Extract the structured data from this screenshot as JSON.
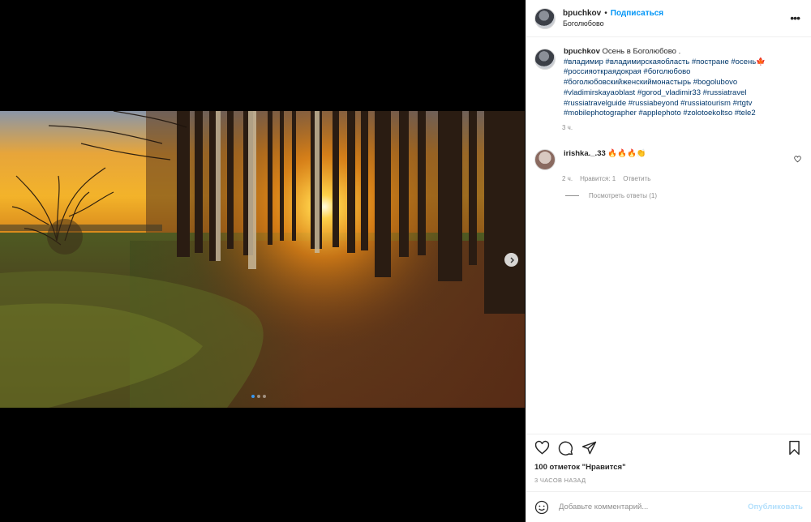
{
  "post": {
    "username": "bpuchkov",
    "separator": "•",
    "follow_label": "Подписаться",
    "location": "Боголюбово",
    "more_label": "•••"
  },
  "caption": {
    "username": "bpuchkov",
    "text": "Осень в Боголюбово .",
    "hashtags_line1": "#владимир #владимирскаяобласть #пострaне #осень🍁",
    "hashtags_rest": "#россияоткраядокрая #боголюбово #боголюбовскийженскиймонастырь #bogolubovo #vladimirskayaoblast #gorod_vladimir33 #russiatravel #russiatravelguide #russiabeyond #russiatourism #rtgtv #mobilephotographer #applephoto #zolotoekoltso #tele2",
    "time": "3 ч."
  },
  "comment": {
    "username": "irishka._.33",
    "text": "🔥🔥🔥👏",
    "time": "2 ч.",
    "likes": "Нравится: 1",
    "reply_label": "Ответить",
    "view_replies": "Посмотреть ответы (1)"
  },
  "footer": {
    "likes_text": "100 отметок \"Нравится\"",
    "time_ago": "3 ЧАСОВ НАЗАД",
    "comment_placeholder": "Добавьте комментарий...",
    "publish_label": "Опубликовать"
  },
  "carousel": {
    "total_slides": 3,
    "active_slide": 1
  },
  "icons": {
    "more": "more-icon",
    "next": "chevron-right-icon",
    "heart": "heart-icon",
    "comment": "comment-icon",
    "share": "share-icon",
    "save": "bookmark-icon",
    "emoji": "emoji-icon"
  },
  "colors": {
    "link": "#0095f6",
    "hashtag": "#00376b",
    "muted": "#8e8e8e",
    "publish_disabled": "#b2dffc"
  }
}
